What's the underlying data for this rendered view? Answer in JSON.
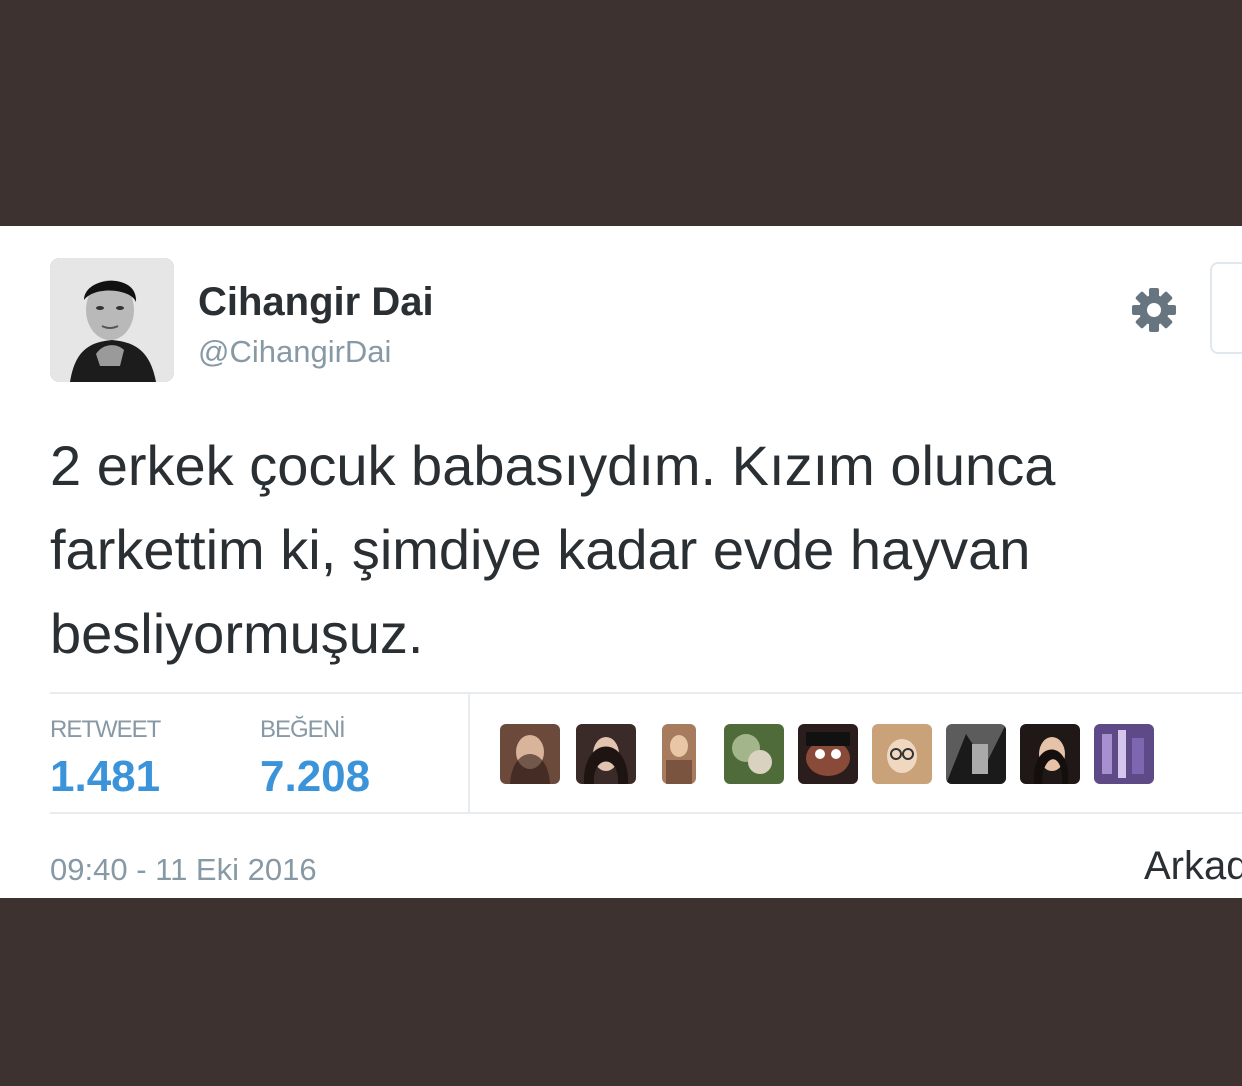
{
  "tweet": {
    "author_name": "Cihangir Dai",
    "author_handle": "@CihangirDai",
    "text": "2 erkek çocuk babasıydım. Kızım olunca\nfarkettim ki, şimdiye kadar evde hayvan\nbesliyormuşuz.",
    "timestamp": "09:40 - 11 Eki 2016",
    "follow_hint": "Arkad"
  },
  "stats": {
    "retweet_label": "RETWEET",
    "retweet_count": "1.481",
    "like_label": "BEĞENİ",
    "like_count": "7.208"
  },
  "icons": {
    "settings": "gear-icon",
    "avatar": "avatar-photo"
  },
  "colors": {
    "background": "#3e3230",
    "card": "#ffffff",
    "text_primary": "#292f33",
    "text_secondary": "#8899a6",
    "accent_blue": "#3b94d9"
  }
}
